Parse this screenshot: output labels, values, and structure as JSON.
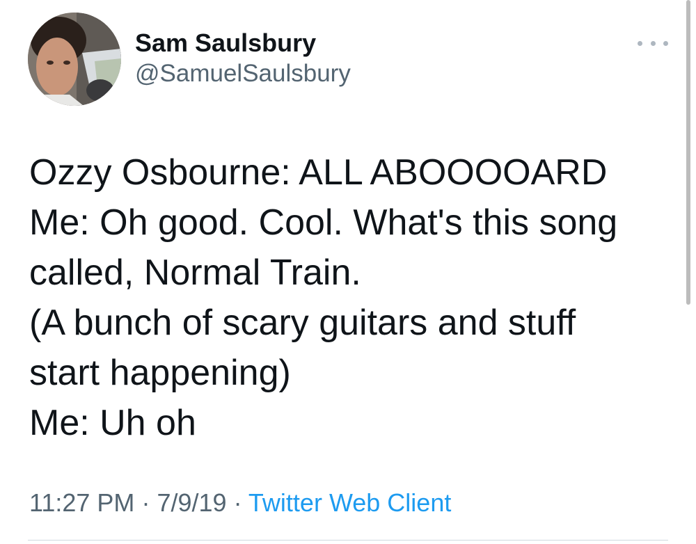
{
  "author": {
    "display_name": "Sam Saulsbury",
    "handle": "@SamuelSaulsbury",
    "avatar_icon": "profile-photo"
  },
  "tweet": {
    "lines": [
      "Ozzy Osbourne: ALL ABOOOOARD",
      "Me: Oh good. Cool. What's this song",
      "called, Normal Train.",
      "(A bunch of scary guitars and stuff",
      "start happening)",
      "Me: Uh oh"
    ]
  },
  "meta": {
    "time": "11:27 PM",
    "separator": "·",
    "date": "7/9/19",
    "source": "Twitter Web Client"
  },
  "more_icon": "more-horizontal-icon",
  "colors": {
    "text": "#0f1419",
    "secondary": "#536471",
    "link": "#1d9bf0"
  }
}
